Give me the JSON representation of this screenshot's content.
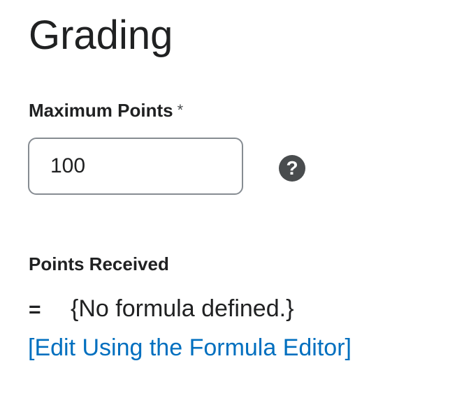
{
  "section": {
    "title": "Grading"
  },
  "max_points": {
    "label": "Maximum Points",
    "required_marker": "*",
    "value": "100",
    "help_icon": "question-circle-icon",
    "help_symbol": "?"
  },
  "points_received": {
    "label": "Points Received",
    "equals": "=",
    "formula_text": "{No formula defined.}",
    "edit_link": "[Edit Using the Formula Editor]"
  },
  "colors": {
    "text": "#202122",
    "link": "#006fbf",
    "input_border": "#868c92",
    "help_icon_bg": "#494c4e"
  }
}
